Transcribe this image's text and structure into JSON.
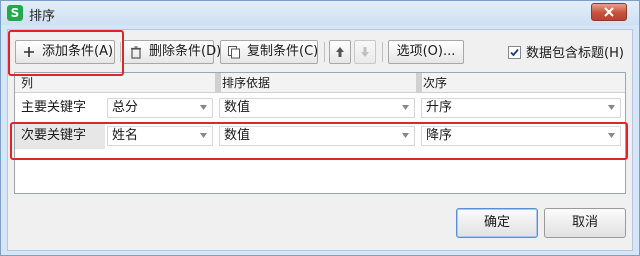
{
  "window": {
    "title": "排序",
    "app_icon_letter": "S"
  },
  "toolbar": {
    "add_label": "添加条件(A)",
    "delete_label": "删除条件(D)",
    "copy_label": "复制条件(C)",
    "options_label": "选项(O)...",
    "has_header_label": "数据包含标题(H)",
    "has_header_checked": true
  },
  "grid": {
    "headers": [
      "列",
      "排序依据",
      "次序"
    ],
    "rows": [
      {
        "key": "主要关键字",
        "column": "总分",
        "basis": "数值",
        "order": "升序"
      },
      {
        "key": "次要关键字",
        "column": "姓名",
        "basis": "数值",
        "order": "降序"
      }
    ]
  },
  "footer": {
    "ok_label": "确定",
    "cancel_label": "取消"
  },
  "colors": {
    "highlight": "#e0242c",
    "title_bg": "#d6e6f7",
    "close": "#c6523d"
  }
}
